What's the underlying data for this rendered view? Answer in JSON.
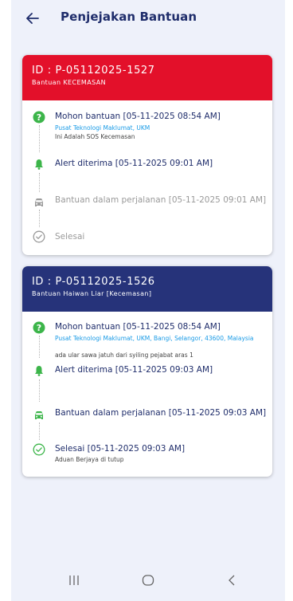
{
  "app": {
    "title": "Penjejakan Bantuan"
  },
  "colors": {
    "card1_header": "#e3102a",
    "card2_header": "#26337a",
    "green": "#3cb54a",
    "grey": "#9a9a9a",
    "link": "#1a9be6",
    "text_dark": "#1f2d6b"
  },
  "cards": [
    {
      "id": "ID : P-05112025-1527",
      "subtitle": "Bantuan KECEMASAN",
      "steps": [
        {
          "icon": "help-circle-icon",
          "label": "Mohon bantuan [05-11-2025 08:54 AM]",
          "link": "Pusat Teknologi Maklumat, UKM",
          "detail": "Ini Adalah SOS Kecemasan"
        },
        {
          "icon": "bell-icon",
          "label": "Alert diterima [05-11-2025 09:01 AM]"
        },
        {
          "icon": "car-icon",
          "label": "Bantuan dalam perjalanan [05-11-2025 09:01 AM]"
        },
        {
          "icon": "check-circle-icon",
          "label": "Selesai"
        }
      ]
    },
    {
      "id": "ID : P-05112025-1526",
      "subtitle": "Bantuan Haiwan Liar [Kecemasan]",
      "steps": [
        {
          "icon": "help-circle-icon",
          "label": "Mohon bantuan [05-11-2025 08:54 AM]",
          "link": "Pusat Teknologi Maklumat, UKM, Bangi, Selangor, 43600, Malaysia",
          "detail": "ada ular sawa jatuh dari syiling pejabat aras 1"
        },
        {
          "icon": "bell-icon",
          "label": "Alert diterima [05-11-2025 09:03 AM]"
        },
        {
          "icon": "car-icon",
          "label": "Bantuan dalam perjalanan [05-11-2025 09:03 AM]"
        },
        {
          "icon": "check-circle-icon",
          "label": "Selesai [05-11-2025 09:03 AM]",
          "detail": "Aduan Berjaya di tutup"
        }
      ]
    }
  ],
  "navbar": {
    "recent_icon": "recent-apps-icon",
    "home_icon": "home-icon",
    "back_icon": "back-nav-icon"
  }
}
